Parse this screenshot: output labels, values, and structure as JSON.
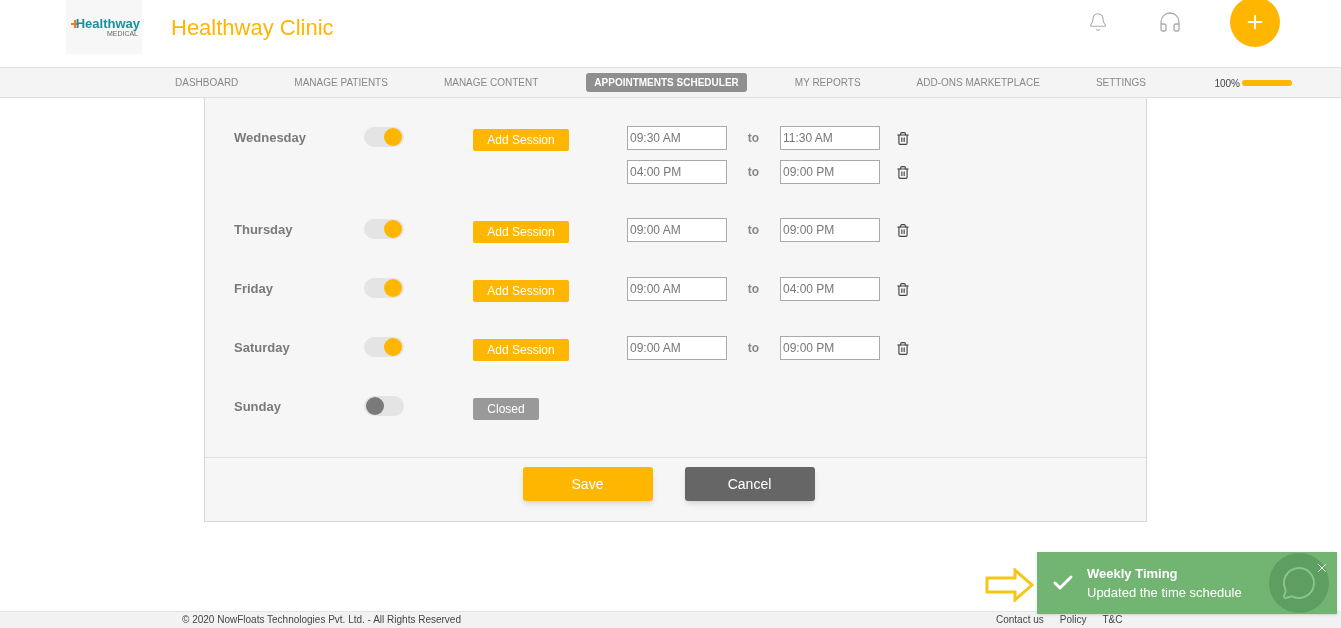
{
  "header": {
    "logo": {
      "name": "Healthway",
      "sub": "MEDICAL"
    },
    "title": "Healthway Clinic"
  },
  "nav": {
    "items": [
      {
        "label": "DASHBOARD",
        "selected": false
      },
      {
        "label": "MANAGE PATIENTS",
        "selected": false
      },
      {
        "label": "MANAGE CONTENT",
        "selected": false
      },
      {
        "label": "APPOINTMENTS SCHEDULER",
        "selected": true
      },
      {
        "label": "MY REPORTS",
        "selected": false
      },
      {
        "label": "ADD-ONS MARKETPLACE",
        "selected": false
      },
      {
        "label": "SETTINGS",
        "selected": false
      }
    ],
    "progress": {
      "reading": "100%",
      "level": 1
    }
  },
  "schedule": {
    "days": [
      {
        "day": "Wednesday",
        "on": true,
        "button": "Add Session",
        "sessions": [
          {
            "from": "09:30 AM",
            "sep": "to",
            "to": "11:30 AM"
          },
          {
            "from": "04:00 PM",
            "sep": "to",
            "to": "09:00 PM"
          }
        ]
      },
      {
        "day": "Thursday",
        "on": true,
        "button": "Add Session",
        "sessions": [
          {
            "from": "09:00 AM",
            "sep": "to",
            "to": "09:00 PM"
          }
        ]
      },
      {
        "day": "Friday",
        "on": true,
        "button": "Add Session",
        "sessions": [
          {
            "from": "09:00 AM",
            "sep": "to",
            "to": "04:00 PM"
          }
        ]
      },
      {
        "day": "Saturday",
        "on": true,
        "button": "Add Session",
        "sessions": [
          {
            "from": "09:00 AM",
            "sep": "to",
            "to": "09:00 PM"
          }
        ]
      },
      {
        "day": "Sunday",
        "on": false,
        "button": "Closed"
      }
    ],
    "actions": {
      "save": "Save",
      "cancel": "Cancel"
    }
  },
  "toast": {
    "title": "Weekly Timing",
    "message": "Updated the time schedule"
  },
  "footer": {
    "copyright": "© 2020 NowFloats Technologies Pvt. Ltd. - All Rights Reserved",
    "links": [
      "Contact us",
      "Policy",
      "T&C"
    ]
  }
}
